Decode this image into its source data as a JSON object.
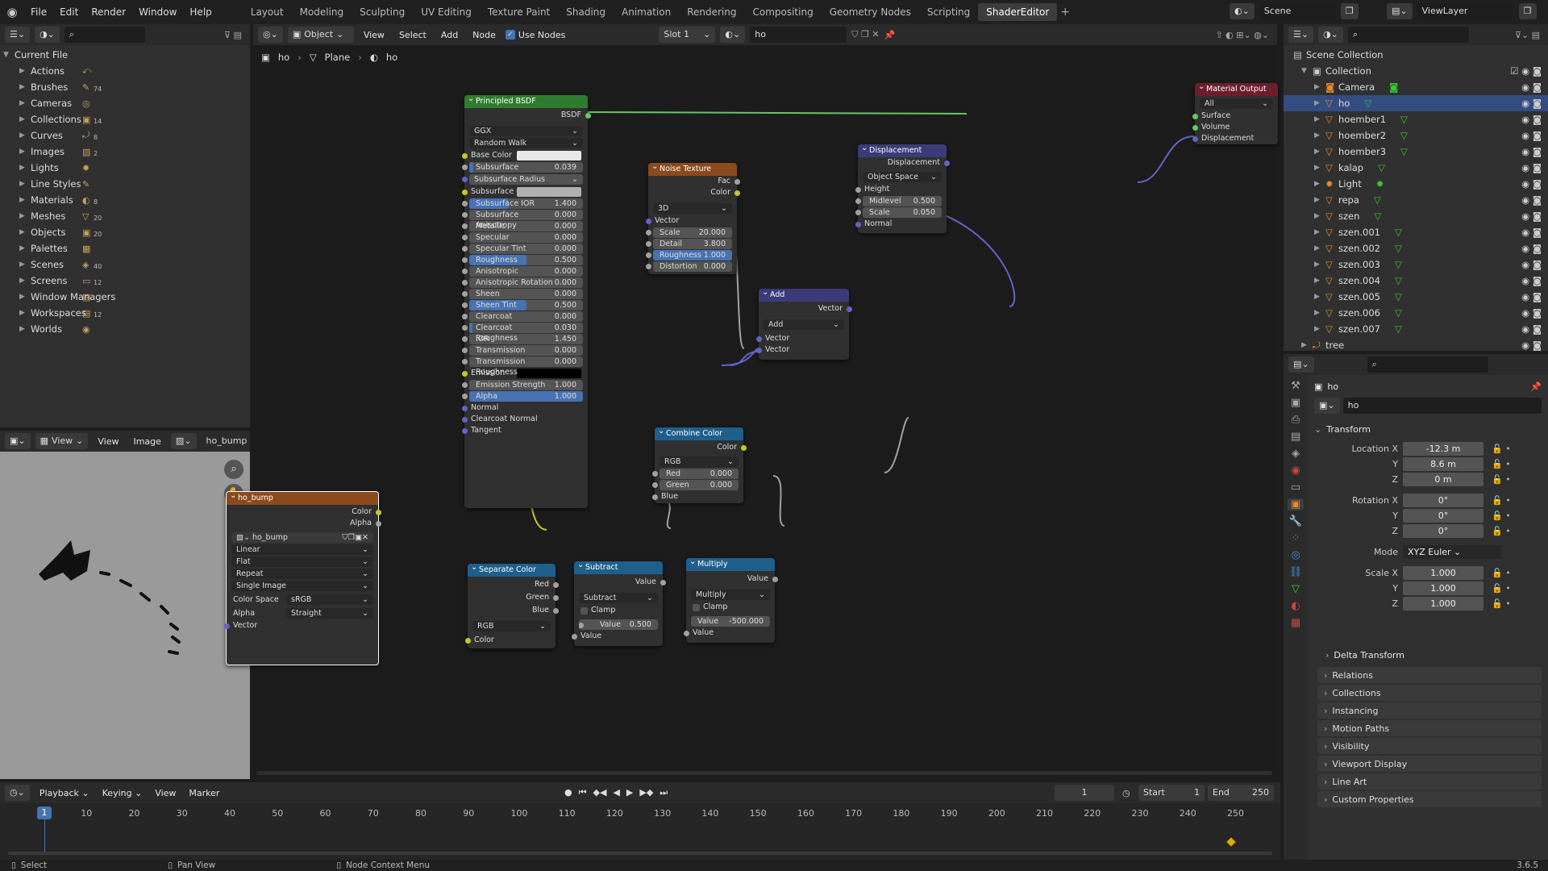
{
  "menu": {
    "items": [
      "File",
      "Edit",
      "Render",
      "Window",
      "Help"
    ]
  },
  "workspaces": [
    "Layout",
    "Modeling",
    "Sculpting",
    "UV Editing",
    "Texture Paint",
    "Shading",
    "Animation",
    "Rendering",
    "Compositing",
    "Geometry Nodes",
    "Scripting",
    "ShaderEditor"
  ],
  "scene_field": "Scene",
  "viewlayer_field": "ViewLayer",
  "outliner_left": {
    "root": "Current File",
    "items": [
      {
        "label": "Actions",
        "count": ""
      },
      {
        "label": "Brushes",
        "count": "74"
      },
      {
        "label": "Cameras",
        "count": ""
      },
      {
        "label": "Collections",
        "count": "14"
      },
      {
        "label": "Curves",
        "count": "8"
      },
      {
        "label": "Images",
        "count": "2"
      },
      {
        "label": "Lights",
        "count": ""
      },
      {
        "label": "Line Styles",
        "count": ""
      },
      {
        "label": "Materials",
        "count": "8"
      },
      {
        "label": "Meshes",
        "count": "20"
      },
      {
        "label": "Objects",
        "count": "20"
      },
      {
        "label": "Palettes",
        "count": ""
      },
      {
        "label": "Scenes",
        "count": "40"
      },
      {
        "label": "Screens",
        "count": "12"
      },
      {
        "label": "Window Managers",
        "count": ""
      },
      {
        "label": "Workspaces",
        "count": "12"
      },
      {
        "label": "Worlds",
        "count": ""
      }
    ]
  },
  "node_header": {
    "mode": "Object",
    "view": "View",
    "select": "Select",
    "add": "Add",
    "node": "Node",
    "use_nodes": "Use Nodes",
    "slot": "Slot 1",
    "material": "ho"
  },
  "breadcrumb": [
    "ho",
    "Plane",
    "ho"
  ],
  "image_editor": {
    "view_menu": "View",
    "view": "View",
    "image": "Image",
    "image_name": "ho_bump"
  },
  "nodes": {
    "bsdf": {
      "title": "Principled BSDF",
      "out": "BSDF",
      "dist": "GGX",
      "sss": "Random Walk",
      "rows": [
        {
          "k": "Base Color",
          "t": "color"
        },
        {
          "k": "Subsurface",
          "v": "0.039",
          "f": 0.039
        },
        {
          "k": "Subsurface Radius",
          "t": "drop"
        },
        {
          "k": "Subsurface C...",
          "t": "color2"
        },
        {
          "k": "Subsurface IOR",
          "v": "1.400",
          "f": 0.35
        },
        {
          "k": "Subsurface Anisotropy",
          "v": "0.000",
          "f": 0
        },
        {
          "k": "Metallic",
          "v": "0.000",
          "f": 0
        },
        {
          "k": "Specular",
          "v": "0.000",
          "f": 0
        },
        {
          "k": "Specular Tint",
          "v": "0.000",
          "f": 0
        },
        {
          "k": "Roughness",
          "v": "0.500",
          "f": 0.5
        },
        {
          "k": "Anisotropic",
          "v": "0.000",
          "f": 0
        },
        {
          "k": "Anisotropic Rotation",
          "v": "0.000",
          "f": 0
        },
        {
          "k": "Sheen",
          "v": "0.000",
          "f": 0
        },
        {
          "k": "Sheen Tint",
          "v": "0.500",
          "f": 0.5
        },
        {
          "k": "Clearcoat",
          "v": "0.000",
          "f": 0
        },
        {
          "k": "Clearcoat Roughness",
          "v": "0.030",
          "f": 0.03
        },
        {
          "k": "IOR",
          "v": "1.450",
          "f": 0
        },
        {
          "k": "Transmission",
          "v": "0.000",
          "f": 0
        },
        {
          "k": "Transmission Roughness",
          "v": "0.000",
          "f": 0
        },
        {
          "k": "Emission",
          "t": "black"
        },
        {
          "k": "Emission Strength",
          "v": "1.000",
          "f": 0
        },
        {
          "k": "Alpha",
          "v": "1.000",
          "f": 1
        },
        {
          "k": "Normal",
          "t": "label"
        },
        {
          "k": "Clearcoat Normal",
          "t": "label"
        },
        {
          "k": "Tangent",
          "t": "label"
        }
      ]
    },
    "noise": {
      "title": "Noise Texture",
      "out1": "Fac",
      "out2": "Color",
      "dim": "3D",
      "vector": "Vector",
      "rows": [
        {
          "k": "Scale",
          "v": "20.000"
        },
        {
          "k": "Detail",
          "v": "3.800"
        },
        {
          "k": "Roughness",
          "v": "1.000"
        },
        {
          "k": "Distortion",
          "v": "0.000"
        }
      ]
    },
    "displacement": {
      "title": "Displacement",
      "out": "Displacement",
      "space": "Object Space",
      "height": "Height",
      "rows": [
        {
          "k": "Midlevel",
          "v": "0.500"
        },
        {
          "k": "Scale",
          "v": "0.050"
        }
      ],
      "normal": "Normal"
    },
    "output": {
      "title": "Material Output",
      "target": "All",
      "inputs": [
        "Surface",
        "Volume",
        "Displacement"
      ]
    },
    "add": {
      "title": "Add",
      "out": "Vector",
      "op": "Add",
      "in1": "Vector",
      "in2": "Vector"
    },
    "combine": {
      "title": "Combine Color",
      "out": "Color",
      "mode": "RGB",
      "rows": [
        {
          "k": "Red",
          "v": "0.000"
        },
        {
          "k": "Green",
          "v": "0.000"
        }
      ],
      "blue": "Blue"
    },
    "imgtex": {
      "title": "ho_bump",
      "out1": "Color",
      "out2": "Alpha",
      "image": "ho_bump",
      "interp": "Linear",
      "proj": "Flat",
      "ext": "Repeat",
      "src": "Single Image",
      "cs_label": "Color Space",
      "cs": "sRGB",
      "alpha_label": "Alpha",
      "alpha": "Straight",
      "vector": "Vector"
    },
    "separate": {
      "title": "Separate Color",
      "outs": [
        "Red",
        "Green",
        "Blue"
      ],
      "mode": "RGB",
      "in": "Color"
    },
    "subtract": {
      "title": "Subtract",
      "out": "Value",
      "op": "Subtract",
      "clamp": "Clamp",
      "vk": "Value",
      "vv": "0.500",
      "in": "Value"
    },
    "multiply": {
      "title": "Multiply",
      "out": "Value",
      "op": "Multiply",
      "clamp": "Clamp",
      "vk": "Value",
      "vv": "-500.000",
      "in": "Value"
    }
  },
  "outliner_right": {
    "root": "Scene Collection",
    "collection": "Collection",
    "items": [
      "Camera",
      "ho",
      "hoember1",
      "hoember2",
      "hoember3",
      "kalap",
      "Light",
      "repa",
      "szen",
      "szen.001",
      "szen.002",
      "szen.003",
      "szen.004",
      "szen.005",
      "szen.006",
      "szen.007"
    ],
    "tree": "tree"
  },
  "properties": {
    "object": "ho",
    "name_field": "ho",
    "transform": "Transform",
    "loc_label": "Location X",
    "loc": [
      "-12.3 m",
      "8.6 m",
      "0 m"
    ],
    "rot_label": "Rotation X",
    "rot": [
      "0°",
      "0°",
      "0°"
    ],
    "mode_label": "Mode",
    "mode": "XYZ Euler",
    "scale_label": "Scale X",
    "scale": [
      "1.000",
      "1.000",
      "1.000"
    ],
    "y": "Y",
    "z": "Z",
    "delta": "Delta Transform",
    "sections": [
      "Relations",
      "Collections",
      "Instancing",
      "Motion Paths",
      "Visibility",
      "Viewport Display",
      "Line Art",
      "Custom Properties"
    ]
  },
  "timeline": {
    "menus": [
      "Playback",
      "Keying",
      "View",
      "Marker"
    ],
    "current": "1",
    "start_label": "Start",
    "start": "1",
    "end_label": "End",
    "end": "250",
    "ticks": [
      "1",
      "10",
      "20",
      "30",
      "40",
      "50",
      "60",
      "70",
      "80",
      "90",
      "100",
      "110",
      "120",
      "130",
      "140",
      "150",
      "160",
      "170",
      "180",
      "190",
      "200",
      "210",
      "220",
      "230",
      "240",
      "250"
    ]
  },
  "status": {
    "select": "Select",
    "pan": "Pan View",
    "ctx": "Node Context Menu",
    "version": "3.6.5"
  },
  "colors": {
    "accent": "#4772b3",
    "shader_node": "#2e7d2e",
    "texture_node": "#8a4a1d",
    "vector_node": "#3b3b7a",
    "converter_node": "#1f5f8b",
    "output_node": "#6e1d2e"
  }
}
